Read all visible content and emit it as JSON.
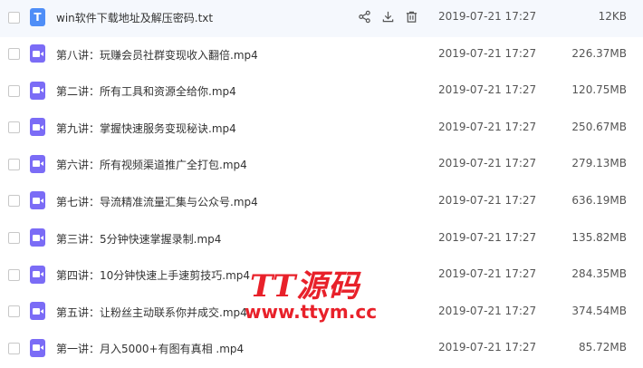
{
  "files": [
    {
      "type": "txt",
      "icon": "txt-file-icon",
      "icon_letter": "T",
      "name": "win软件下载地址及解压密码.txt",
      "date": "2019-07-21 17:27",
      "size": "12KB",
      "hover": true
    },
    {
      "type": "video",
      "icon": "video-file-icon",
      "name": "第八讲：玩赚会员社群变现收入翻倍.mp4",
      "date": "2019-07-21 17:27",
      "size": "226.37MB"
    },
    {
      "type": "video",
      "icon": "video-file-icon",
      "name": "第二讲：所有工具和资源全给你.mp4",
      "date": "2019-07-21 17:27",
      "size": "120.75MB"
    },
    {
      "type": "video",
      "icon": "video-file-icon",
      "name": "第九讲：掌握快速服务变现秘诀.mp4",
      "date": "2019-07-21 17:27",
      "size": "250.67MB"
    },
    {
      "type": "video",
      "icon": "video-file-icon",
      "name": "第六讲：所有视频渠道推广全打包.mp4",
      "date": "2019-07-21 17:27",
      "size": "279.13MB"
    },
    {
      "type": "video",
      "icon": "video-file-icon",
      "name": "第七讲：导流精准流量汇集与公众号.mp4",
      "date": "2019-07-21 17:27",
      "size": "636.19MB"
    },
    {
      "type": "video",
      "icon": "video-file-icon",
      "name": "第三讲：5分钟快速掌握录制.mp4",
      "date": "2019-07-21 17:27",
      "size": "135.82MB"
    },
    {
      "type": "video",
      "icon": "video-file-icon",
      "name": "第四讲：10分钟快速上手速剪技巧.mp4",
      "date": "2019-07-21 17:27",
      "size": "284.35MB"
    },
    {
      "type": "video",
      "icon": "video-file-icon",
      "name": "第五讲：让粉丝主动联系你并成交.mp4",
      "date": "2019-07-21 17:27",
      "size": "374.54MB"
    },
    {
      "type": "video",
      "icon": "video-file-icon",
      "name": "第一讲：月入5000+有图有真相 .mp4",
      "date": "2019-07-21 17:27",
      "size": "85.72MB"
    }
  ],
  "row_actions": [
    {
      "icon": "share-icon"
    },
    {
      "icon": "download-icon"
    },
    {
      "icon": "delete-icon"
    }
  ],
  "watermark": {
    "line1": "TT源码",
    "line2": "www.ttym.cc",
    "color": "#e8212a"
  },
  "colors": {
    "txt_icon": "#4f8ef7",
    "video_icon": "#7b6cf6",
    "hover_row": "#f5f8fd"
  }
}
